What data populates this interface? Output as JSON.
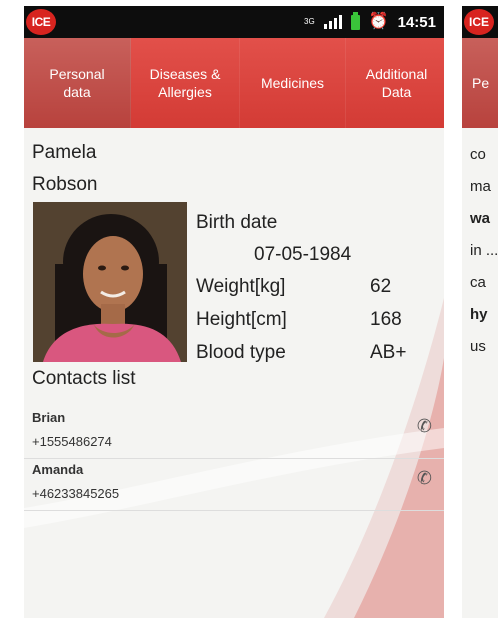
{
  "status_bar": {
    "app_badge": "ICE",
    "network": "3G",
    "time": "14:51"
  },
  "tabs": [
    {
      "label_line1": "Personal",
      "label_line2": "data",
      "active": true
    },
    {
      "label_line1": "Diseases &",
      "label_line2": "Allergies",
      "active": false
    },
    {
      "label_line1": "Medicines",
      "label_line2": "",
      "active": false
    },
    {
      "label_line1": "Additional",
      "label_line2": "Data",
      "active": false
    }
  ],
  "profile": {
    "first_name": "Pamela",
    "last_name": "Robson",
    "birth_date_label": "Birth date",
    "birth_date": "07-05-1984",
    "weight_label": "Weight[kg]",
    "weight": "62",
    "height_label": "Height[cm]",
    "height": "168",
    "blood_type_label": "Blood type",
    "blood_type": "AB+"
  },
  "contacts": {
    "title": "Contacts list",
    "items": [
      {
        "name": "Brian",
        "phone": "+1555486274",
        "call_icon": "phone-icon"
      },
      {
        "name": "Amanda",
        "phone": "+46233845265",
        "call_icon": "phone-icon"
      }
    ]
  },
  "second_screen": {
    "app_badge": "ICE",
    "tab_partial": "Pe",
    "lines": [
      "co",
      "ma",
      "wa",
      "in ...",
      "ca",
      "hy",
      "us"
    ]
  },
  "colors": {
    "accent_red": "#d8241f",
    "tab_bar": "#e2504a",
    "active_tab": "#b8423d",
    "status_bar": "#0d0d0d"
  }
}
